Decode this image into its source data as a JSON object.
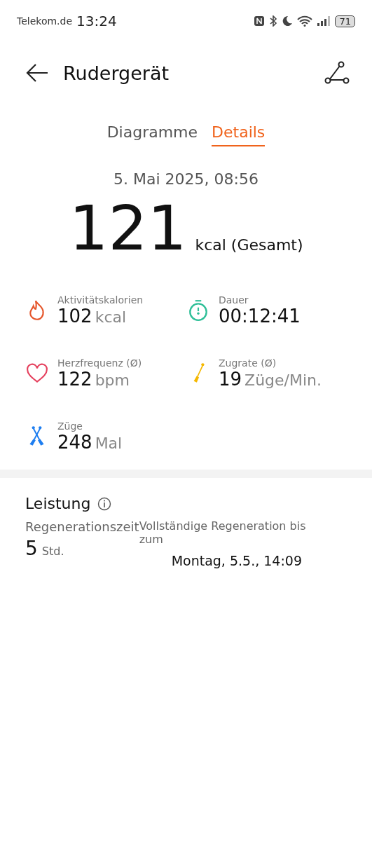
{
  "status_bar": {
    "carrier": "Telekom.de",
    "time": "13:24",
    "battery": "71"
  },
  "header": {
    "title": "Rudergerät"
  },
  "tabs": [
    {
      "label": "Diagramme",
      "selected": false
    },
    {
      "label": "Details",
      "selected": true
    }
  ],
  "date": "5. Mai 2025, 08:56",
  "total": {
    "value": "121",
    "unit": "kcal (Gesamt)"
  },
  "metrics": [
    {
      "kind": "flame",
      "label": "Aktivitätskalorien",
      "value": "102",
      "unit": "kcal"
    },
    {
      "kind": "stopwatch",
      "label": "Dauer",
      "value": "00:12:41"
    },
    {
      "kind": "heart",
      "label": "Herzfrequenz (Ø)",
      "value": "122",
      "unit": "bpm"
    },
    {
      "kind": "oar",
      "label": "Zugrate (Ø)",
      "value": "19",
      "unit": "Züge/Min."
    },
    {
      "kind": "oars",
      "label": "Züge",
      "value": "248",
      "unit": "Mal"
    }
  ],
  "performance": {
    "title": "Leistung",
    "recovery_label": "Regenerationszeit",
    "recovery_value": "5",
    "recovery_unit": "Std.",
    "full_label": "Vollständige Regeneration bis zum",
    "full_value": "Montag, 5.5., 14:09"
  }
}
